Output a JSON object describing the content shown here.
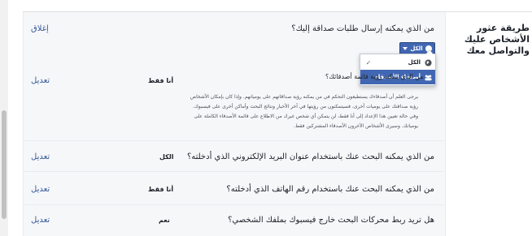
{
  "section": {
    "title": "طريقة عثور الأشخاص عليك والتواصل معك",
    "close_link": "إغلاق"
  },
  "expanded": {
    "question": "من الذي يمكنه إرسال طلبات صداقة إليك؟",
    "privacy_button_label": "الكل",
    "dropdown": {
      "options": [
        {
          "label": "الكل",
          "icon": "globe-icon",
          "selected": true
        },
        {
          "label": "أصدقاء الأصدقاء",
          "icon": "friends-icon",
          "highlighted": true
        }
      ]
    }
  },
  "rows": [
    {
      "question": "من الذي يمكنه رؤية قائمة أصدقائك؟",
      "value": "أنا فقط",
      "edit": "تعديل",
      "description": "يرجى العلم أن أصدقاءك يستطيعون التحكم في من يمكنه رؤية صداقاتهم على يومياتهم. وإذا كان بإمكان الأشخاص رؤية صداقتك على يوميات أخرى، فسيتمكنون من رؤيتها في آخر الأخبار ونتائج البحث وأماكن أخرى على فيسبوك. وفي حالة تعيين هذا الإعداد إلى أنا فقط، لن يتمكن أي شخص غيرك من الاطلاع على قائمة الأصدقاء الكاملة على يومياتك. وسيرى الأشخاص الآخرون الأصدقاء المشتركين فقط."
    },
    {
      "question": "من الذي يمكنه البحث عنك باستخدام عنوان البريد الإلكتروني الذي أدخلته؟",
      "value": "الكل",
      "edit": "تعديل"
    },
    {
      "question": "من الذي يمكنه البحث عنك باستخدام رقم الهاتف الذي أدخلته؟",
      "value": "أنا فقط",
      "edit": "تعديل"
    },
    {
      "question": "هل تريد ربط محركات البحث خارج فيسبوك بملفك الشخصي؟",
      "value": "نعم",
      "edit": "تعديل"
    }
  ]
}
